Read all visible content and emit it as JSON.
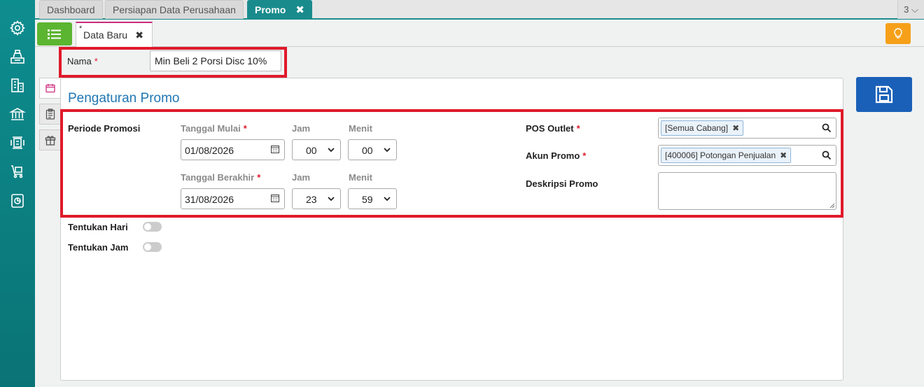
{
  "top_tabs": [
    {
      "label": "Dashboard",
      "active": false
    },
    {
      "label": "Persiapan Data Perusahaan",
      "active": false
    },
    {
      "label": "Promo",
      "active": true
    }
  ],
  "tab_count": "3 ⌵",
  "doc_tab": {
    "modified_mark": "*",
    "label": "Data Baru"
  },
  "nama": {
    "label": "Nama",
    "required": "*",
    "value": "Min Beli 2 Porsi Disc 10%"
  },
  "panel": {
    "title": "Pengaturan Promo"
  },
  "periode": {
    "label": "Periode Promosi",
    "start": {
      "date_label": "Tanggal Mulai",
      "date_value": "01/08/2026",
      "hour_label": "Jam",
      "hour_value": "00",
      "minute_label": "Menit",
      "minute_value": "00"
    },
    "end": {
      "date_label": "Tanggal Berakhir",
      "date_value": "31/08/2026",
      "hour_label": "Jam",
      "hour_value": "23",
      "minute_label": "Menit",
      "minute_value": "59"
    }
  },
  "pos_outlet": {
    "label": "POS Outlet",
    "chip": "[Semua Cabang]"
  },
  "akun_promo": {
    "label": "Akun Promo",
    "chip": "[400006] Potongan Penjualan"
  },
  "deskripsi": {
    "label": "Deskripsi Promo",
    "value": ""
  },
  "toggles": {
    "hari_label": "Tentukan Hari",
    "hari_on": false,
    "jam_label": "Tentukan Jam",
    "jam_on": false
  },
  "required_mark": "*",
  "colors": {
    "teal": "#1a8b8d",
    "green": "#5cb531",
    "orange": "#f6a01a",
    "blue": "#1a60b8",
    "highlight": "#e01a2b",
    "title": "#1f77b4"
  }
}
